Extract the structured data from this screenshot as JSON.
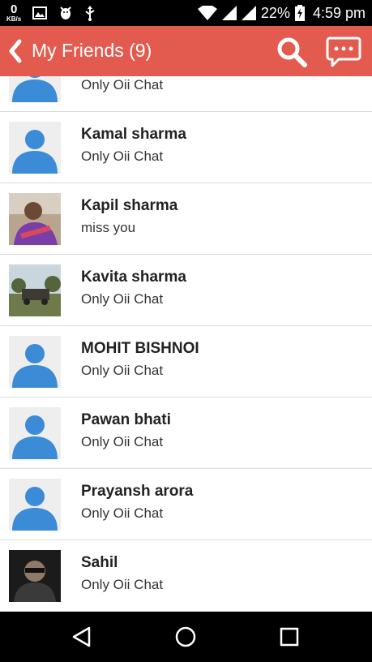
{
  "status_bar": {
    "speed_value": "0",
    "speed_unit": "KB/s",
    "battery": "22%",
    "time": "4:59 pm"
  },
  "app_bar": {
    "title": "My Friends (9)"
  },
  "friends": [
    {
      "name": "",
      "message": "Only Oii Chat",
      "avatar": "default"
    },
    {
      "name": "Kamal sharma",
      "message": "Only Oii Chat",
      "avatar": "default"
    },
    {
      "name": "Kapil sharma",
      "message": "miss you",
      "avatar": "photo-person"
    },
    {
      "name": "Kavita sharma",
      "message": "Only Oii Chat",
      "avatar": "photo-landscape"
    },
    {
      "name": "MOHIT BISHNOI",
      "message": "Only Oii Chat",
      "avatar": "default"
    },
    {
      "name": "Pawan bhati",
      "message": "Only Oii Chat",
      "avatar": "default"
    },
    {
      "name": "Prayansh arora",
      "message": "Only Oii Chat",
      "avatar": "default"
    },
    {
      "name": "Sahil",
      "message": "Only Oii Chat",
      "avatar": "photo-dark"
    }
  ],
  "colors": {
    "app_bar": "#e35a4f",
    "avatar_icon": "#3b8bd6",
    "status_bar": "#000000"
  }
}
